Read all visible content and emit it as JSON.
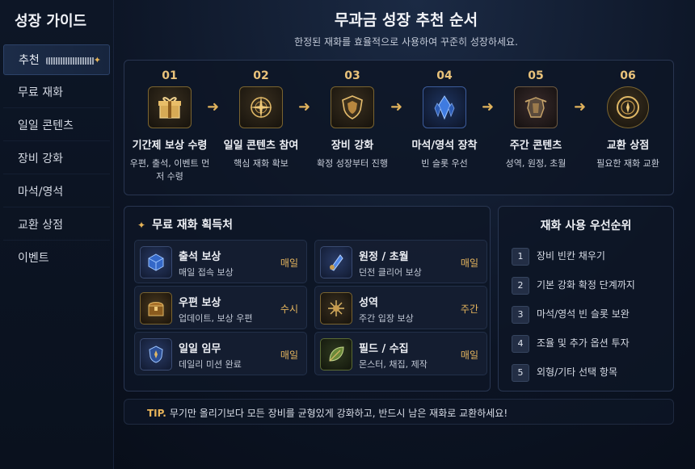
{
  "sidebar": {
    "title": "성장 가이드",
    "items": [
      {
        "label": "추천"
      },
      {
        "label": "무료 재화"
      },
      {
        "label": "일일 콘텐츠"
      },
      {
        "label": "장비 강화"
      },
      {
        "label": "마석/영석"
      },
      {
        "label": "교환 상점"
      },
      {
        "label": "이벤트"
      }
    ]
  },
  "header": {
    "title": "무과금 성장 추천 순서",
    "subtitle": "한정된 재화를 효율적으로 사용하여 꾸준히 성장하세요."
  },
  "steps": [
    {
      "num": "01",
      "name": "기간제 보상 수령",
      "desc": "우편, 출석, 이벤트 먼저 수령",
      "icon": "gift-icon"
    },
    {
      "num": "02",
      "name": "일일 콘텐츠 참여",
      "desc": "핵심 재화 확보",
      "icon": "compass-icon"
    },
    {
      "num": "03",
      "name": "장비 강화",
      "desc": "확정 성장부터 진행",
      "icon": "shield-icon"
    },
    {
      "num": "04",
      "name": "마석/영석 장착",
      "desc": "빈 슬롯 우선",
      "icon": "crystal-icon"
    },
    {
      "num": "05",
      "name": "주간 콘텐츠",
      "desc": "성역, 원정, 초월",
      "icon": "armor-icon"
    },
    {
      "num": "06",
      "name": "교환 상점",
      "desc": "필요한 재화 교환",
      "icon": "emblem-icon"
    }
  ],
  "free_sources": {
    "title": "무료 재화 획득처",
    "items": [
      {
        "title": "출석 보상",
        "desc": "매일 접속 보상",
        "freq": "매일",
        "icon": "cube-icon"
      },
      {
        "title": "원정 / 초월",
        "desc": "던전 클리어 보상",
        "freq": "매일",
        "icon": "crystal-shard-icon"
      },
      {
        "title": "우편 보상",
        "desc": "업데이트, 보상 우편",
        "freq": "수시",
        "icon": "chest-icon"
      },
      {
        "title": "성역",
        "desc": "주간 입장 보상",
        "freq": "주간",
        "icon": "sanctum-icon"
      },
      {
        "title": "일일 임무",
        "desc": "데일리 미션 완료",
        "freq": "매일",
        "icon": "badge-icon"
      },
      {
        "title": "필드 / 수집",
        "desc": "몬스터, 채집, 제작",
        "freq": "매일",
        "icon": "leaf-icon"
      }
    ]
  },
  "priority": {
    "title": "재화 사용 우선순위",
    "items": [
      {
        "n": "1",
        "label": "장비 빈칸 채우기"
      },
      {
        "n": "2",
        "label": "기본 강화 확정 단계까지"
      },
      {
        "n": "3",
        "label": "마석/영석 빈 슬롯 보완"
      },
      {
        "n": "4",
        "label": "조율 및 추가 옵션 투자"
      },
      {
        "n": "5",
        "label": "외형/기타 선택 항목"
      }
    ]
  },
  "tip": {
    "label": "TIP.",
    "text": "무기만 올리기보다 모든 장비를 균형있게 강화하고, 반드시 남은 재화로 교환하세요!"
  },
  "colors": {
    "accent": "#e7b458",
    "panel_border": "#283550",
    "background": "#0c1424"
  }
}
